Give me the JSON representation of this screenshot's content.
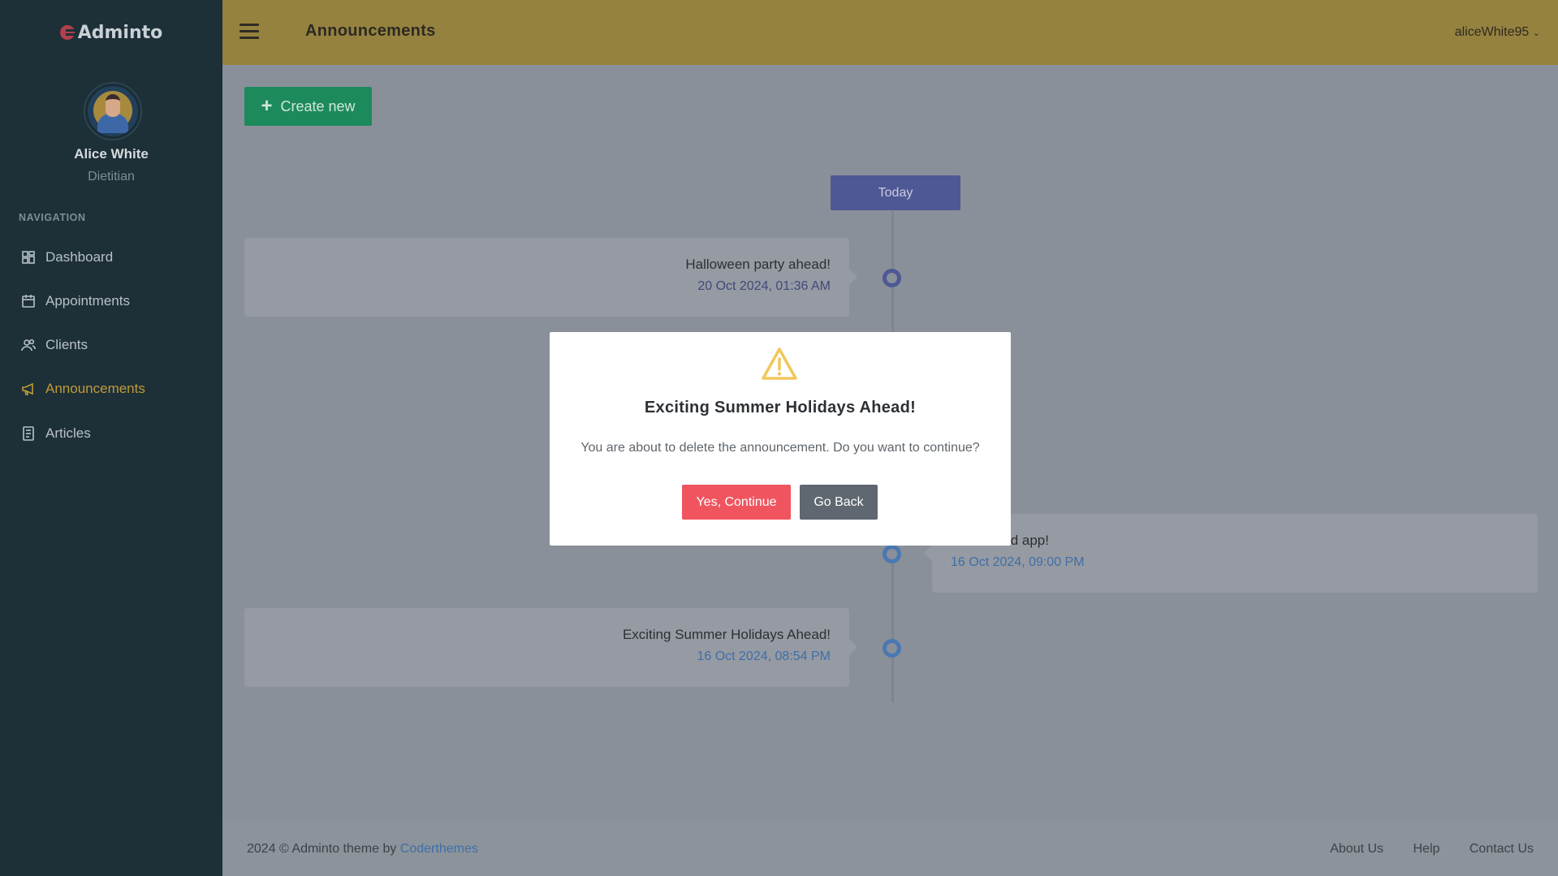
{
  "app": {
    "name": "Adminto"
  },
  "user": {
    "name": "Alice White",
    "role": "Dietitian",
    "username": "aliceWhite95"
  },
  "sidebar": {
    "section_title": "NAVIGATION",
    "items": [
      {
        "label": "Dashboard",
        "icon": "dashboard-icon",
        "active": false
      },
      {
        "label": "Appointments",
        "icon": "calendar-icon",
        "active": false
      },
      {
        "label": "Clients",
        "icon": "users-icon",
        "active": false
      },
      {
        "label": "Announcements",
        "icon": "megaphone-icon",
        "active": true
      },
      {
        "label": "Articles",
        "icon": "document-icon",
        "active": false
      }
    ]
  },
  "header": {
    "title": "Announcements",
    "user_menu": "aliceWhite95"
  },
  "toolbar": {
    "create_label": "Create new"
  },
  "timeline": {
    "today_label": "Today",
    "entries": [
      {
        "title": "Halloween party ahead!",
        "date": "20 Oct 2024, 01:36 AM",
        "side": "left"
      },
      {
        "title": "ew android app!",
        "date": "16 Oct 2024, 09:00 PM",
        "side": "right"
      },
      {
        "title": "Exciting Summer Holidays Ahead!",
        "date": "16 Oct 2024, 08:54 PM",
        "side": "left"
      }
    ]
  },
  "modal": {
    "icon": "warning-icon",
    "title": "Exciting Summer Holidays Ahead!",
    "message": "You are about to delete the announcement. Do you want to continue?",
    "confirm_label": "Yes, Continue",
    "cancel_label": "Go Back"
  },
  "footer": {
    "copyright": "2024 © Adminto theme by ",
    "author_link": "Coderthemes",
    "links": [
      "About Us",
      "Help",
      "Contact Us"
    ]
  },
  "colors": {
    "sidebar_bg": "#1d3038",
    "topbar_bg": "#96823f",
    "accent_active": "#c09a38",
    "create_button": "#1d8a5c",
    "today_badge": "#4e5894",
    "confirm_button": "#f0555f",
    "cancel_button": "#5f6770",
    "warning": "#f1c75b"
  }
}
